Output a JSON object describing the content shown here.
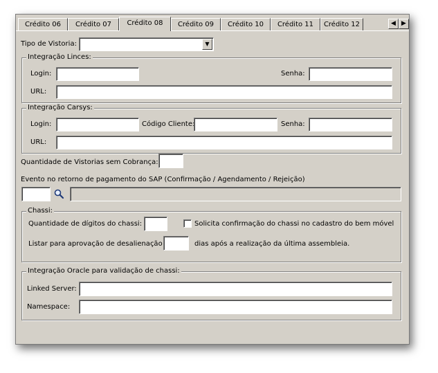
{
  "tabs": [
    {
      "label": "Crédito 06"
    },
    {
      "label": "Crédito 07"
    },
    {
      "label": "Crédito 08"
    },
    {
      "label": "Crédito 09"
    },
    {
      "label": "Crédito 10"
    },
    {
      "label": "Crédito 11"
    },
    {
      "label": "Crédito 12"
    }
  ],
  "active_tab": "Crédito 08",
  "tipo_vistoria": {
    "label": "Tipo de Vistoria:",
    "value": ""
  },
  "lince": {
    "title": "Integração Linces:",
    "login_label": "Login:",
    "senha_label": "Senha:",
    "url_label": "URL:"
  },
  "carsys": {
    "title": "Integração Carsys:",
    "login_label": "Login:",
    "codigo_label": "Código Cliente:",
    "senha_label": "Senha:",
    "url_label": "URL:"
  },
  "qtd_vistorias_label": "Quantidade de Vistorias sem Cobrança:",
  "evento_label": "Evento no retorno de pagamento do SAP (Confirmação / Agendamento / Rejeição)",
  "chassi": {
    "title": "Chassi:",
    "qtd_digitos_label": "Quantidade de dígitos do chassi:",
    "solicita_label": "Solicita confirmação do chassi no cadastro do bem móvel",
    "listar_label": "Listar para aprovação de desalienação",
    "dias_label": "dias após a realização da última assembleia."
  },
  "oracle": {
    "title": "Integração Oracle para validação de chassi:",
    "linked_label": "Linked Server:",
    "namespace_label": "Namespace:"
  },
  "icons": {
    "search": "search-icon",
    "left": "arrow-left-icon",
    "right": "arrow-right-icon",
    "dropdown": "chevron-down-icon"
  }
}
